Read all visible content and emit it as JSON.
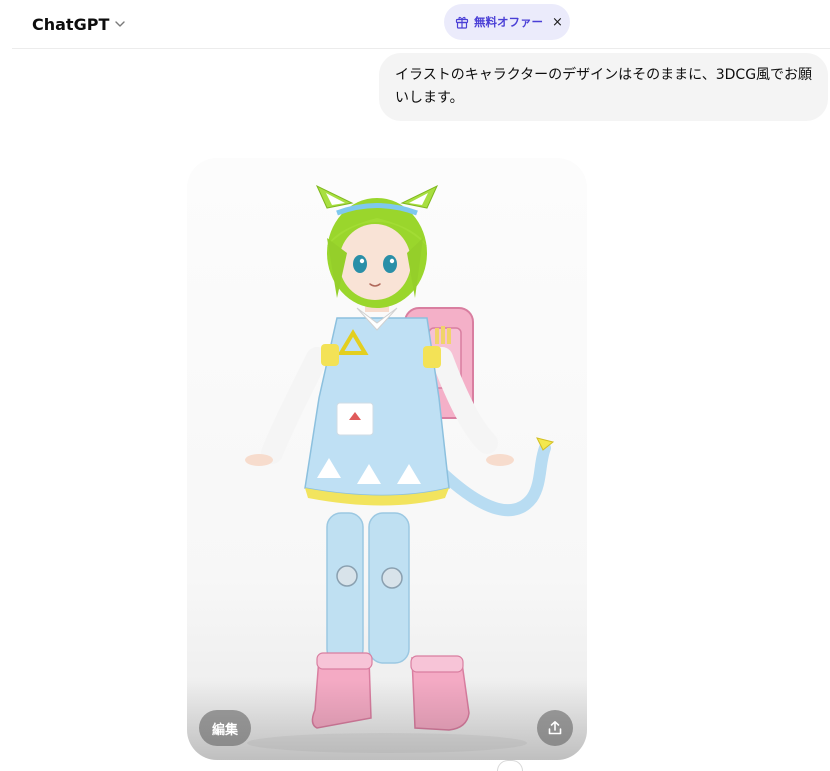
{
  "header": {
    "model_name": "ChatGPT",
    "offer_label": "無料オファー",
    "offer_close": "×"
  },
  "conversation": {
    "user_message": "イラストのキャラクターのデザインはそのままに、3DCG風でお願いします。"
  },
  "image_card": {
    "edit_label": "編集"
  },
  "icons": {
    "model_chevron": "chevron-down-icon",
    "offer": "gift-icon",
    "share": "share-icon"
  },
  "colors": {
    "offer_bg": "#ebebfb",
    "offer_text": "#4a3fd6",
    "bubble_bg": "#f4f4f4"
  }
}
